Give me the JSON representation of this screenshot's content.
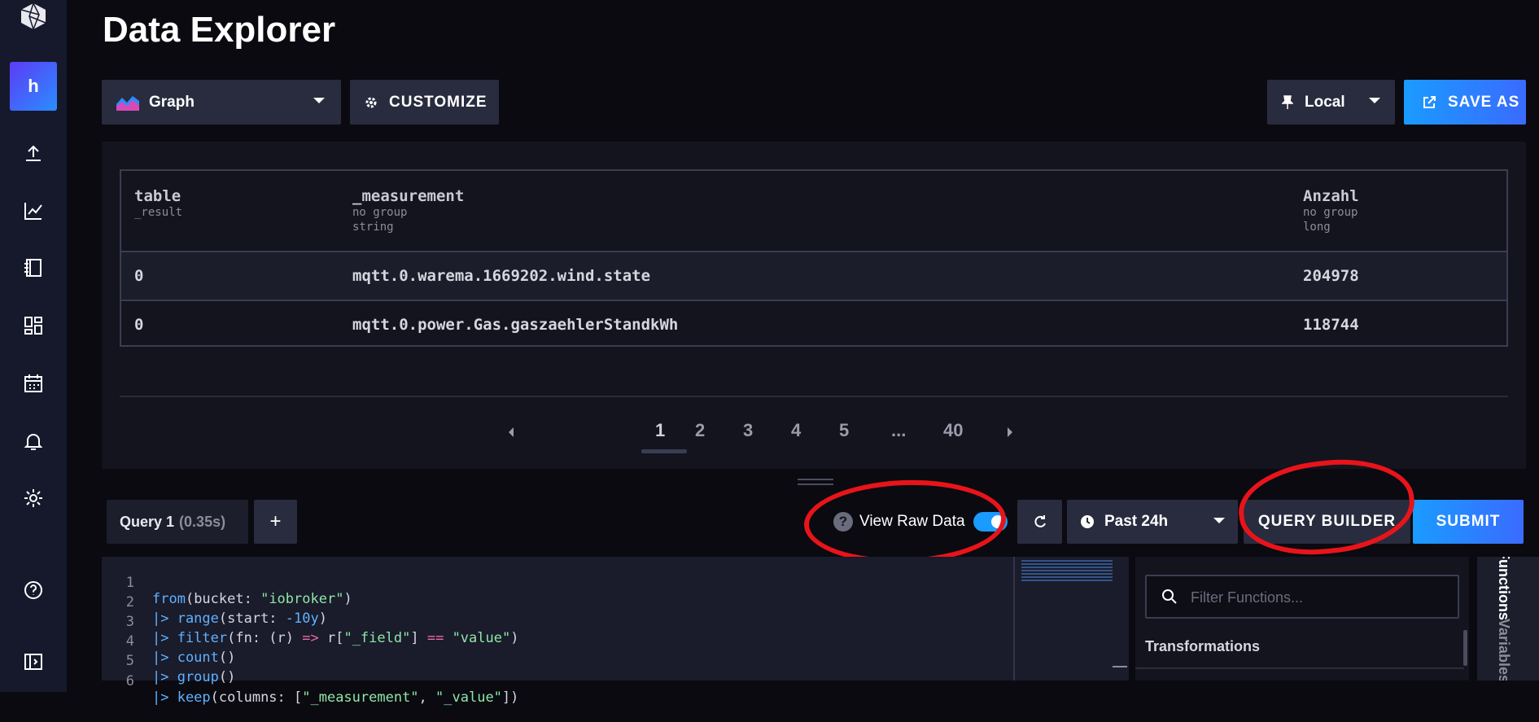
{
  "sidebar": {
    "org_initial": "h",
    "icons": [
      "upload-icon",
      "graph-icon",
      "notebook-icon",
      "dashboards-icon",
      "calendar-icon",
      "bell-icon",
      "gear-icon",
      "help-icon",
      "collapse-icon"
    ]
  },
  "page_title": "Data Explorer",
  "toolbar": {
    "vis_type": "Graph",
    "customize_label": "CUSTOMIZE",
    "timezone": "Local",
    "save_as_label": "SAVE AS"
  },
  "table": {
    "columns": [
      {
        "name": "table",
        "sub1": "_result",
        "sub2": ""
      },
      {
        "name": "_measurement",
        "sub1": "no group",
        "sub2": "string"
      },
      {
        "name": "Anzahl",
        "sub1": "no group",
        "sub2": "long"
      }
    ],
    "rows": [
      [
        "0",
        "mqtt.0.warema.1669202.wind.state",
        "204978"
      ],
      [
        "0",
        "mqtt.0.power.Gas.gaszaehlerStandkWh",
        "118744"
      ]
    ]
  },
  "pagination": {
    "pages": [
      "1",
      "2",
      "3",
      "4",
      "5",
      "...",
      "40"
    ],
    "current": "1"
  },
  "query_bar": {
    "tab_name": "Query 1",
    "tab_time": "(0.35s)",
    "add_label": "+",
    "raw_data_label": "View Raw Data",
    "raw_data_on": true,
    "time_range": "Past 24h",
    "query_builder_label": "QUERY BUILDER",
    "submit_label": "SUBMIT"
  },
  "editor": {
    "line_numbers": [
      "1",
      "2",
      "3",
      "4",
      "5",
      "6"
    ]
  },
  "flux_panel": {
    "filter_placeholder": "Filter Functions...",
    "section_title": "Transformations",
    "tab_functions": "Functions",
    "tab_variables": "Variables"
  },
  "colors": {
    "accent": "#1a9bff",
    "annotation": "#e8141a"
  }
}
